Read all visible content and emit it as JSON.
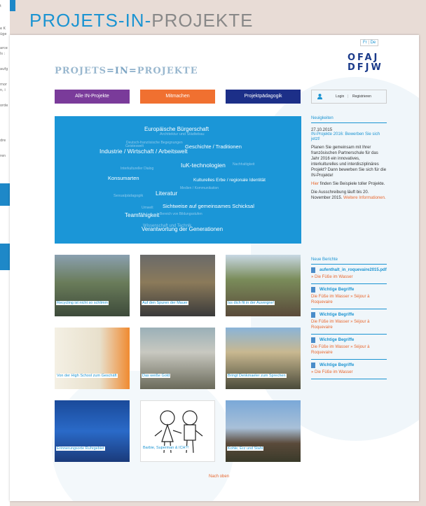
{
  "background_window": {
    "fragments": [
      "t",
      "e K",
      "üge",
      "arce",
      "ls :",
      "aufg",
      "mor",
      "n, i",
      "orde",
      "dre",
      "ren"
    ]
  },
  "header": {
    "title_part1": "PROJETS-IN-",
    "title_part2": "PROJEKTE"
  },
  "lang": {
    "fr": "Fr",
    "sep": "|",
    "de": "De"
  },
  "org_logo": {
    "line1": "OFAJ",
    "line2": "DFJW"
  },
  "site_logo": {
    "part1": "PROJETS",
    "part2": "=IN=",
    "part3": "PROJEKTE"
  },
  "nav": [
    {
      "label": "Alle IN-Projekte"
    },
    {
      "label": "Mitmachen"
    },
    {
      "label": "Projektpädagogik"
    }
  ],
  "login": {
    "login": "Login",
    "sep": "|",
    "register": "Registrieren"
  },
  "tag_cloud": [
    "Europäische Bürgerschaft",
    "Architektur und Städtebau",
    "Deutsch-französische Begegnungen",
    "Geschichte / Traditionen",
    "Industrie / Wirtschaft / Arbeitswelt",
    "Geisteswelt",
    "IuK-technologien",
    "Nachhaltigkeit",
    "Interkultureller Dialog",
    "Kulturelles Erbe / regionale Identität",
    "Konsumarten",
    "Sexualpädagogik",
    "Literatur",
    "Medien / Kommunikation",
    "Sichtweise auf gemeinsames Schicksal",
    "Umwelt",
    "Teamfähigkeit",
    "Bereich von Bildungsstufen",
    "Wissenschaft und Technik",
    "Verantwortung der Generationen"
  ],
  "news": {
    "heading": "Neuigkeiten",
    "date": "27.10.2015",
    "title": "IN-Projekte 2016: Bewerben Sie sich jetzt!",
    "body": "Planen Sie gemeinsam mit Ihrer französischen Partnerschule für das Jahr 2016 ein innovatives, interkulturelles und interdisziplinäres Projekt? Dann bewerben Sie sich für die IN-Projekte!",
    "hier": "Hier",
    "hier_rest": " finden Sie Beispiele toller Projekte.",
    "deadline": "Die Ausschreibung läuft bis 20. November 2015.",
    "more": "Weitere Informationen."
  },
  "berichte": {
    "heading": "Neue Berichte",
    "items": [
      {
        "title": "aufenthalt_in_roquevaire2015.pdf",
        "sub": "» Die Füße im Wasser"
      },
      {
        "title": "Wichtige Begriffe",
        "sub": "Die Füße im Wasser » Séjour à Roquevaire"
      },
      {
        "title": "Wichtige Begriffe",
        "sub": "Die Füße im Wasser » Séjour à Roquevaire"
      },
      {
        "title": "Wichtige Begriffe",
        "sub": "Die Füße im Wasser » Séjour à Roquevaire"
      },
      {
        "title": "Wichtige Begriffe",
        "sub": "» Die Füße im Wasser"
      }
    ]
  },
  "tiles": [
    {
      "caption": "Recycling ist nicht so schlimm"
    },
    {
      "caption": "Auf den Spuren der Mauer"
    },
    {
      "caption": "Iss dich fit in der Auvergne!"
    },
    {
      "caption": "Von der High School zum Geschäft"
    },
    {
      "caption": "Das weiße Gold"
    },
    {
      "caption": "Bringt Denkmaeler zum Sprechen"
    },
    {
      "caption": "Erinnerungsorte Ruhrgebiet"
    },
    {
      "caption": "Barbie, Superman & ICH?!"
    },
    {
      "caption": "Kohle, Erz und Stahl"
    }
  ],
  "footer": {
    "back_to_top": "Nach oben"
  },
  "colors": {
    "accent_blue": "#1b94d2",
    "purple": "#7a3b9a",
    "orange": "#f07030",
    "navy": "#1c2f88"
  }
}
